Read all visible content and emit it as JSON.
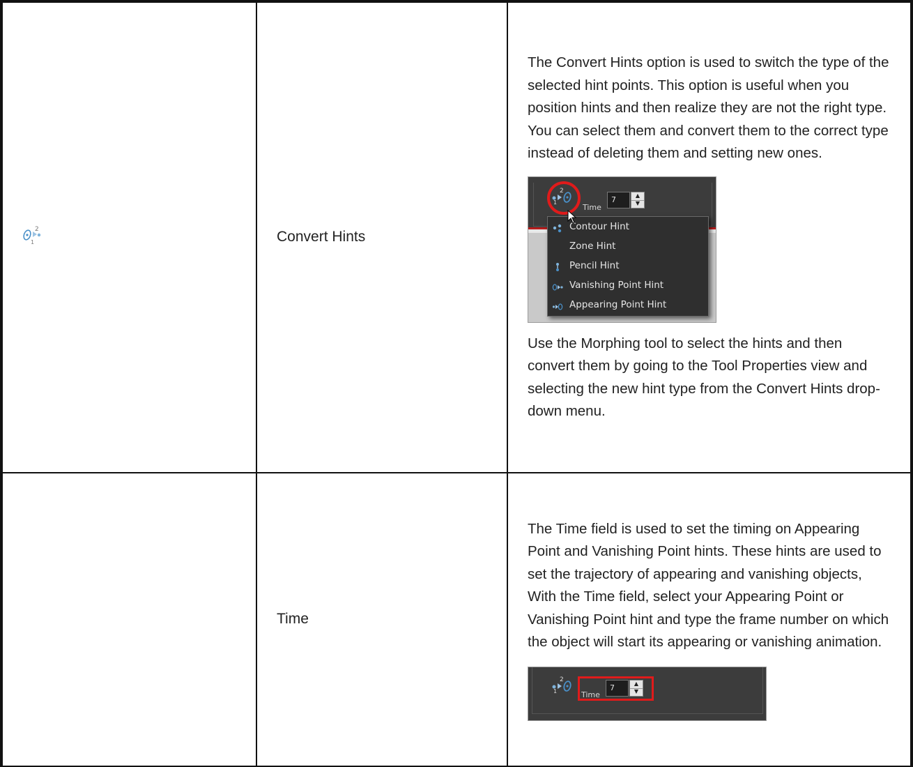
{
  "rows": [
    {
      "icon": "vanishing-point-hint-icon",
      "name": "Convert Hints",
      "description_1": "The Convert Hints option is used to switch the type of the selected hint points. This option is useful when you position hints and then realize they are not the right type. You can select them and convert them to the correct type instead of deleting them and setting new ones.",
      "screenshot": {
        "time_label": "Time",
        "time_value": "7",
        "menu_items": [
          {
            "label": "Contour Hint",
            "icon": "contour-hint-icon"
          },
          {
            "label": "Zone Hint",
            "icon": ""
          },
          {
            "label": "Pencil Hint",
            "icon": "pencil-hint-icon"
          },
          {
            "label": "Vanishing Point Hint",
            "icon": "vanishing-point-hint-icon"
          },
          {
            "label": "Appearing Point Hint",
            "icon": "appearing-point-hint-icon"
          }
        ]
      },
      "description_2": "Use the Morphing tool to select the hints and then convert them by going to the Tool Properties view and selecting the new hint type from the Convert Hints drop-down menu."
    },
    {
      "icon": "",
      "name": "Time",
      "description_1": "The Time field is used to set the timing on Appearing Point and Vanishing Point hints. These hints are used to set the trajectory of appearing and vanishing objects, With the Time field, select your Appearing Point or Vanishing Point hint and type the frame number on which the object will start its appearing or vanishing animation.",
      "screenshot": {
        "time_label": "Time",
        "time_value": "7"
      }
    }
  ],
  "colors": {
    "border": "#111111",
    "highlight_red": "#e01b1b",
    "hint_blue": "#4a90c8"
  }
}
